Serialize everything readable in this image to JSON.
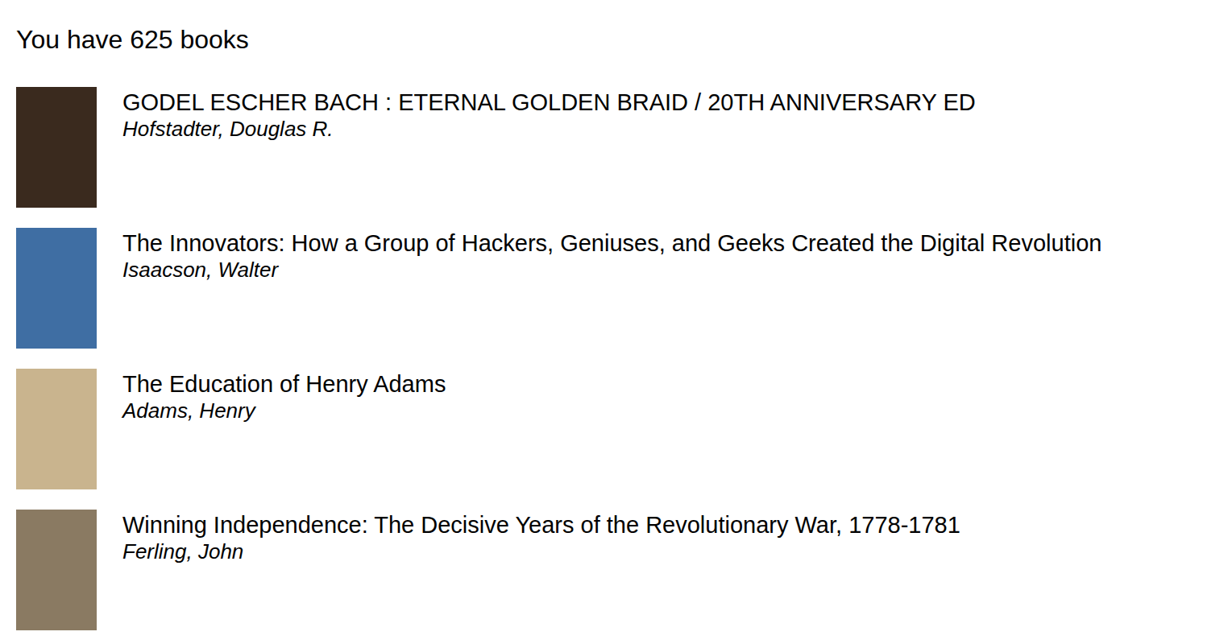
{
  "heading": "You have 625 books",
  "books": [
    {
      "title": "GODEL ESCHER BACH : ETERNAL GOLDEN BRAID / 20TH ANNIVERSARY ED",
      "author": "Hofstadter, Douglas R.",
      "color": "#3a2a1e"
    },
    {
      "title": "The Innovators: How a Group of Hackers, Geniuses, and Geeks Created the Digital Revolution",
      "author": "Isaacson, Walter",
      "color": "#3f6ea3"
    },
    {
      "title": "The Education of Henry Adams",
      "author": "Adams, Henry",
      "color": "#c9b48e"
    },
    {
      "title": "Winning Independence: The Decisive Years of the Revolutionary War, 1778-1781",
      "author": "Ferling, John",
      "color": "#8a7a62"
    }
  ]
}
